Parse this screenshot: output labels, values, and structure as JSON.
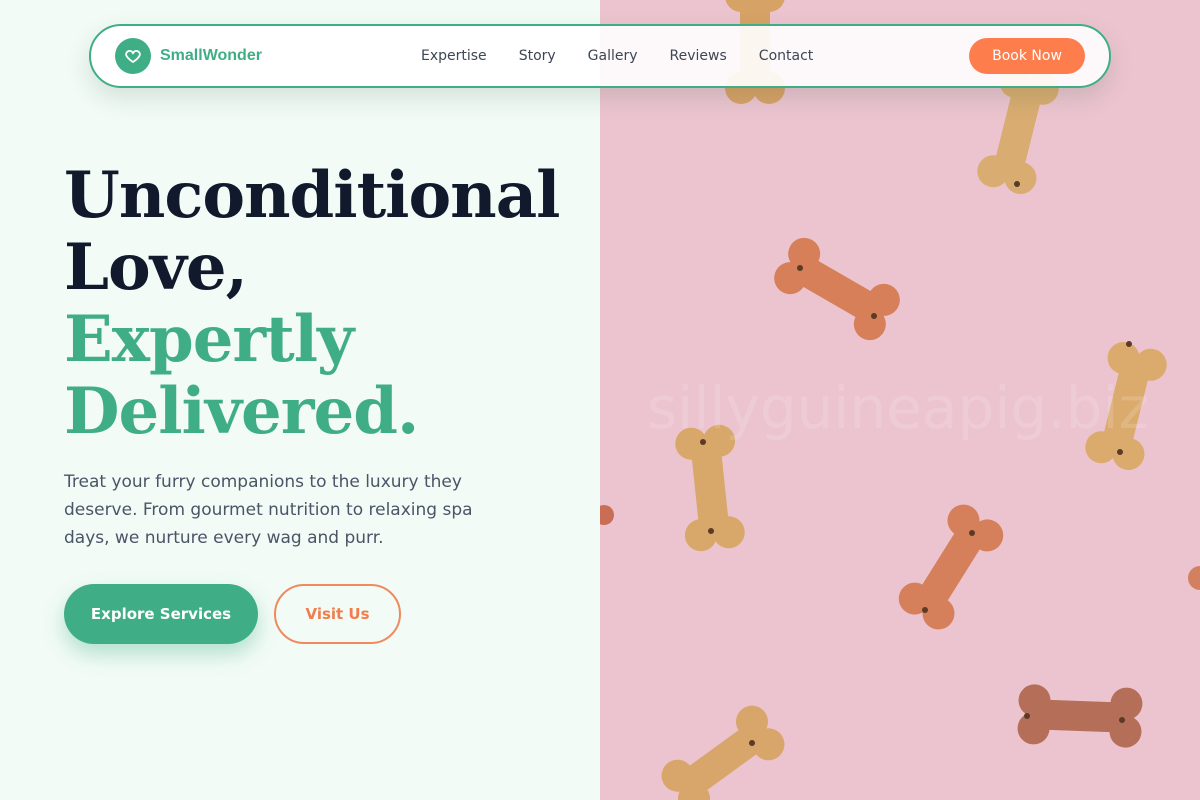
{
  "brand": {
    "name": "SmallWonder",
    "icon": "heart-icon"
  },
  "nav": {
    "links": [
      "Expertise",
      "Story",
      "Gallery",
      "Reviews",
      "Contact"
    ],
    "cta": "Book Now"
  },
  "hero": {
    "line1": "Unconditional",
    "line2": "Love,",
    "line3": "Expertly",
    "line4": "Delivered.",
    "subtitle": "Treat your furry companions to the luxury they deserve. From gourmet nutrition to relaxing spa days, we nurture every wag and purr.",
    "primary_cta": "Explore Services",
    "secondary_cta": "Visit Us"
  },
  "image": {
    "subject": "dog bone biscuits on pink background",
    "watermark": "sillyguineapig.biz"
  },
  "colors": {
    "accent": "#3fae86",
    "cta": "#fd7d4d",
    "dark": "#111a2c",
    "image_bg": "#ecc4cf"
  }
}
